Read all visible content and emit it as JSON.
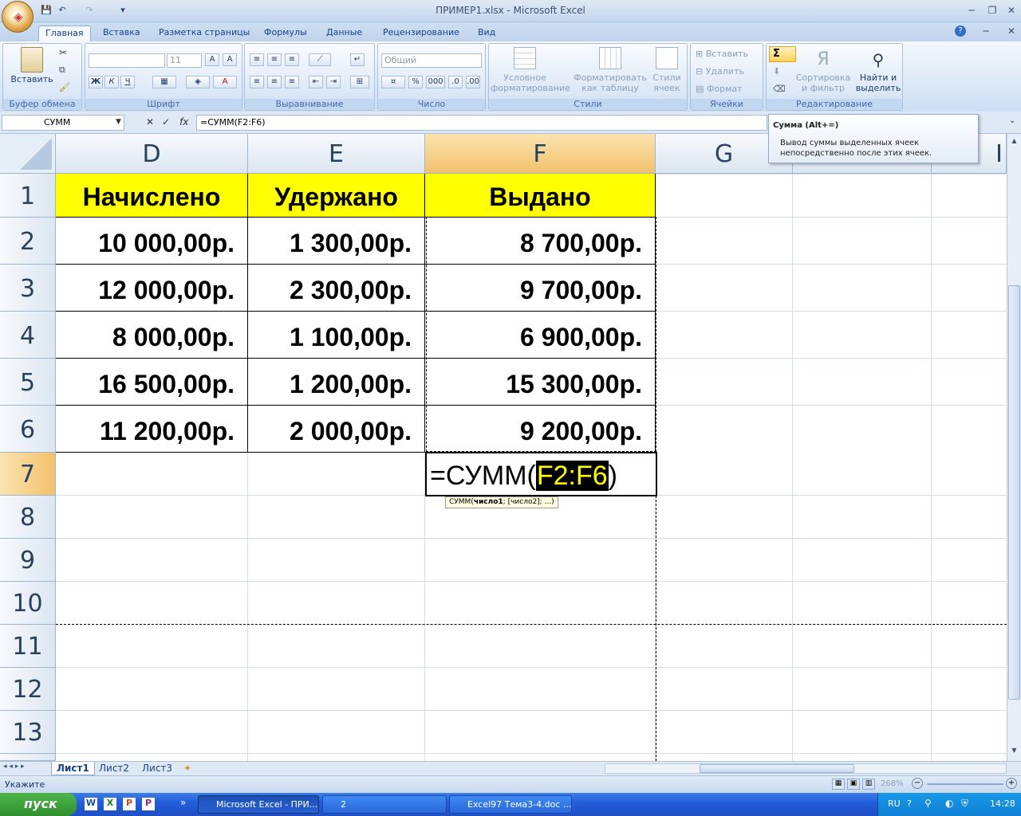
{
  "window": {
    "title": "ПРИМЕР1.xlsx - Microsoft Excel"
  },
  "ribbon_tabs": [
    "Главная",
    "Вставка",
    "Разметка страницы",
    "Формулы",
    "Данные",
    "Рецензирование",
    "Вид"
  ],
  "groups": {
    "clipboard": {
      "label": "Буфер обмена",
      "paste": "Вставить"
    },
    "font": {
      "label": "Шрифт",
      "size": "11",
      "bold": "Ж",
      "italic": "К",
      "underline": "Ч"
    },
    "alignment": {
      "label": "Выравнивание"
    },
    "number": {
      "label": "Число",
      "format": "Общий",
      "thousands": "000"
    },
    "styles": {
      "label": "Стили",
      "conditional_1": "Условное",
      "conditional_2": "форматирование",
      "format_table_1": "Форматировать",
      "format_table_2": "как таблицу",
      "cell_styles_1": "Стили",
      "cell_styles_2": "ячеек"
    },
    "cells": {
      "label": "Ячейки",
      "insert": "Вставить",
      "delete": "Удалить",
      "format": "Формат"
    },
    "editing": {
      "label": "Редактирование",
      "sort_1": "Сортировка",
      "sort_2": "и фильтр",
      "find_1": "Найти и",
      "find_2": "выделить",
      "sum_symbol": "Σ"
    }
  },
  "formula_bar": {
    "name_box": "СУММ",
    "fx": "fx",
    "formula": "=СУММ(F2:F6)"
  },
  "tooltip": {
    "title": "Сумма (Alt+=)",
    "line1": "Вывод суммы выделенных ячеек",
    "line2": "непосредственно после этих ячеек."
  },
  "columns": [
    "D",
    "E",
    "F",
    "G",
    "",
    "I"
  ],
  "rows": [
    "1",
    "2",
    "3",
    "4",
    "5",
    "6",
    "7",
    "8",
    "9",
    "10",
    "11",
    "12",
    "13"
  ],
  "table": {
    "headers": [
      "Начислено",
      "Удержано",
      "Выдано"
    ],
    "data": [
      [
        "10 000,00р.",
        "1 300,00р.",
        "8 700,00р."
      ],
      [
        "12 000,00р.",
        "2 300,00р.",
        "9 700,00р."
      ],
      [
        "8 000,00р.",
        "1 100,00р.",
        "6 900,00р."
      ],
      [
        "16 500,00р.",
        "1 200,00р.",
        "15 300,00р."
      ],
      [
        "11 200,00р.",
        "2 000,00р.",
        "9 200,00р."
      ]
    ]
  },
  "edit_cell": {
    "prefix": "=СУММ(",
    "range": "F2:F6",
    "suffix": ")",
    "hint_name": "СУММ(",
    "hint_arg1": "число1",
    "hint_rest": "; [число2]; ...)"
  },
  "sheets": [
    "Лист1",
    "Лист2",
    "Лист3"
  ],
  "status": {
    "mode": "Укажите",
    "zoom": "268%"
  },
  "taskbar": {
    "start": "пуск",
    "tasks": [
      "Microsoft Excel - ПРИ...",
      "2",
      "Excel97 Тема3-4.doc ..."
    ],
    "lang": "RU",
    "clock": "14:28"
  },
  "colors": {
    "header_fill": "#ffff00",
    "range_highlight": "#000000",
    "range_text": "#ffff00",
    "selected_header": "#f2c16c"
  }
}
